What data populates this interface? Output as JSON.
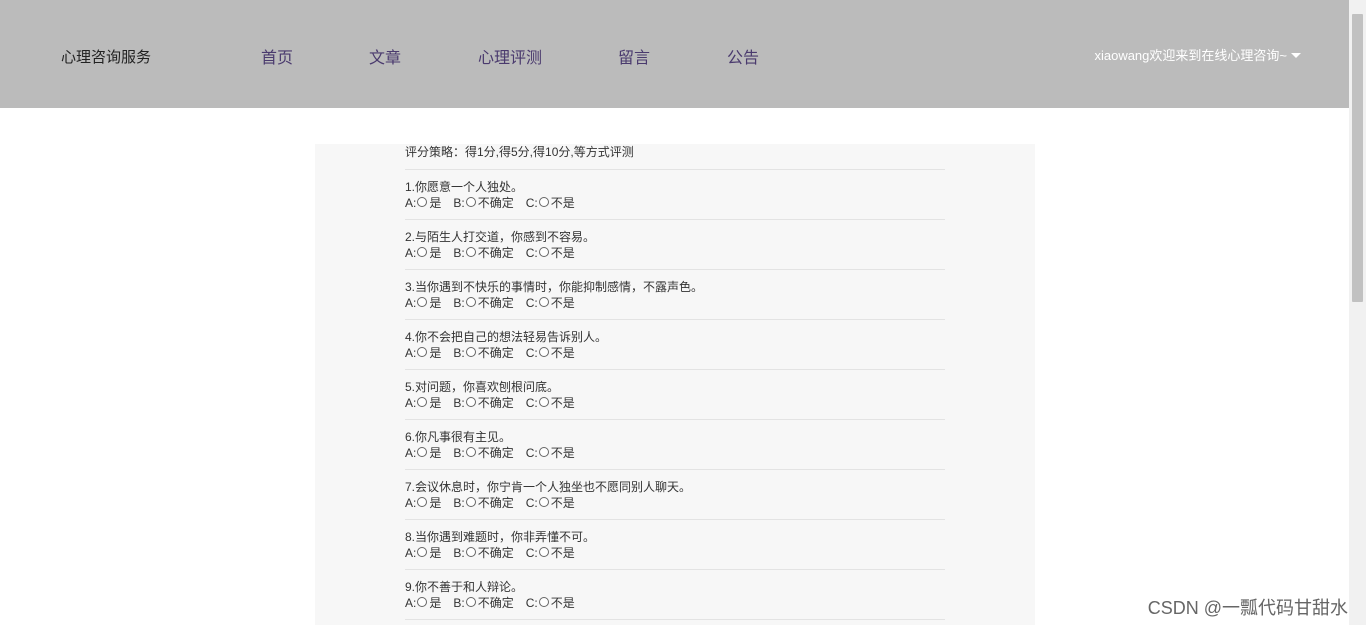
{
  "header": {
    "brand": "心理咨询服务",
    "nav": [
      {
        "label": "首页"
      },
      {
        "label": "文章"
      },
      {
        "label": "心理评测"
      },
      {
        "label": "留言"
      },
      {
        "label": "公告"
      }
    ],
    "user_menu": "xiaowang欢迎来到在线心理咨询~"
  },
  "survey": {
    "strategy": "评分策略：得1分,得5分,得10分,等方式评测",
    "option_prefixes": [
      "A:",
      "B:",
      "C:"
    ],
    "option_labels": [
      "是",
      "不确定",
      "不是"
    ],
    "questions": [
      {
        "text": "1.你愿意一个人独处。"
      },
      {
        "text": "2.与陌生人打交道，你感到不容易。"
      },
      {
        "text": "3.当你遇到不快乐的事情时，你能抑制感情，不露声色。"
      },
      {
        "text": "4.你不会把自己的想法轻易告诉别人。"
      },
      {
        "text": "5.对问题，你喜欢刨根问底。"
      },
      {
        "text": "6.你凡事很有主见。"
      },
      {
        "text": "7.会议休息时，你宁肯一个人独坐也不愿同别人聊天。"
      },
      {
        "text": "8.当你遇到难题时，你非弄懂不可。"
      },
      {
        "text": "9.你不善于和人辩论。"
      }
    ]
  },
  "watermark": "CSDN @一瓢代码甘甜水"
}
